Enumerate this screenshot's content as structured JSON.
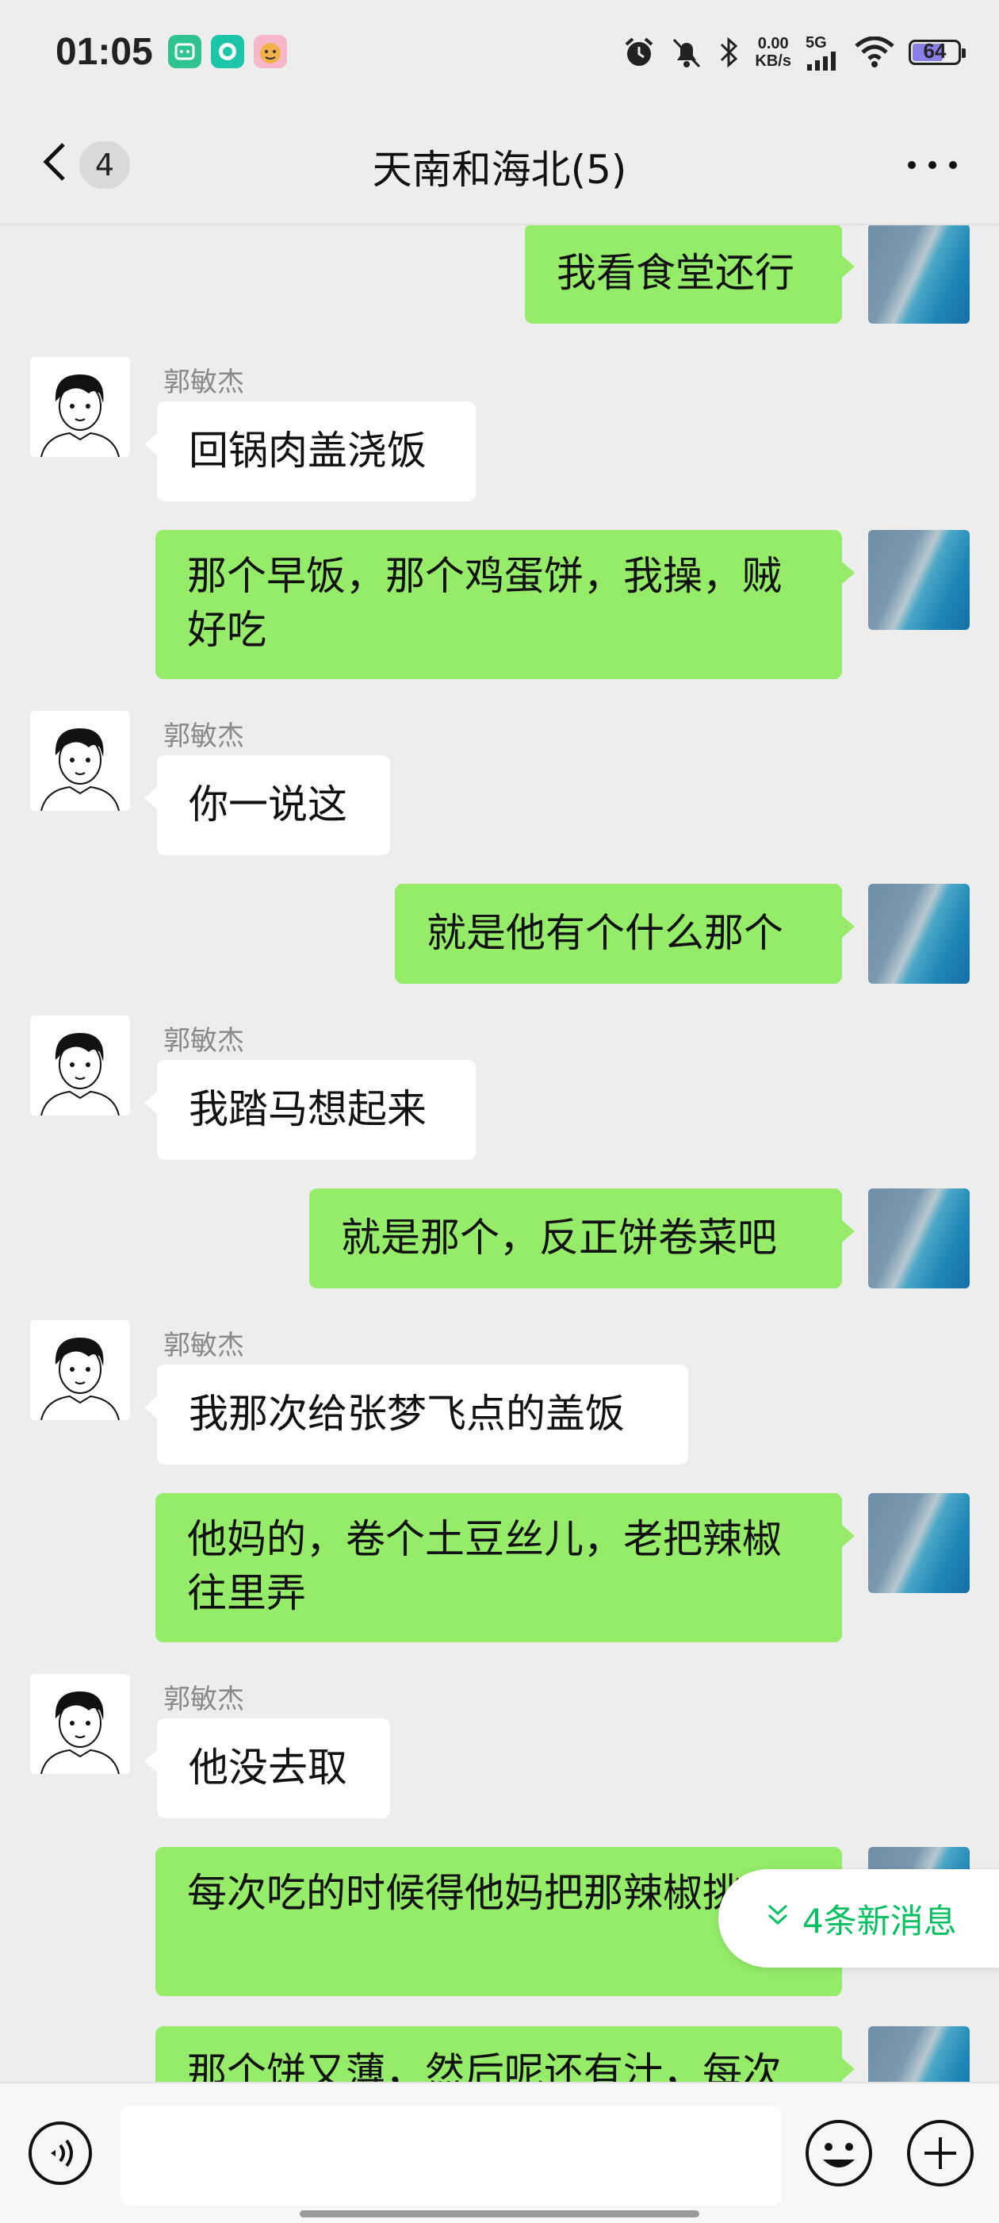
{
  "status_bar": {
    "time": "01:05",
    "net_rate_value": "0.00",
    "net_rate_unit": "KB/s",
    "network": "5G",
    "battery": "64",
    "icons": [
      "app-icon-1",
      "app-icon-2",
      "app-icon-3",
      "alarm-icon",
      "mute-icon",
      "bluetooth-icon",
      "signal-icon",
      "wifi-icon",
      "battery-icon"
    ]
  },
  "header": {
    "unread_count": "4",
    "title": "天南和海北(5)"
  },
  "messages": [
    {
      "side": "right",
      "text": "我看食堂还行"
    },
    {
      "side": "left",
      "sender": "郭敏杰",
      "text": "回锅肉盖浇饭"
    },
    {
      "side": "right",
      "text": "那个早饭，那个鸡蛋饼，我操，贼好吃"
    },
    {
      "side": "left",
      "sender": "郭敏杰",
      "text": "你一说这"
    },
    {
      "side": "right",
      "text": "就是他有个什么那个"
    },
    {
      "side": "left",
      "sender": "郭敏杰",
      "text": "我踏马想起来"
    },
    {
      "side": "right",
      "text": "就是那个，反正饼卷菜吧"
    },
    {
      "side": "left",
      "sender": "郭敏杰",
      "text": "我那次给张梦飞点的盖饭"
    },
    {
      "side": "right",
      "text": "他妈的，卷个土豆丝儿，老把辣椒往里弄"
    },
    {
      "side": "left",
      "sender": "郭敏杰",
      "text": "他没去取"
    },
    {
      "side": "right",
      "text": "每次吃的时候得他妈把那辣椒挑"
    },
    {
      "side": "right",
      "text": "那个饼又薄，然后呢还有汁，每次"
    }
  ],
  "new_messages": "4条新消息",
  "input": {
    "placeholder": ""
  }
}
